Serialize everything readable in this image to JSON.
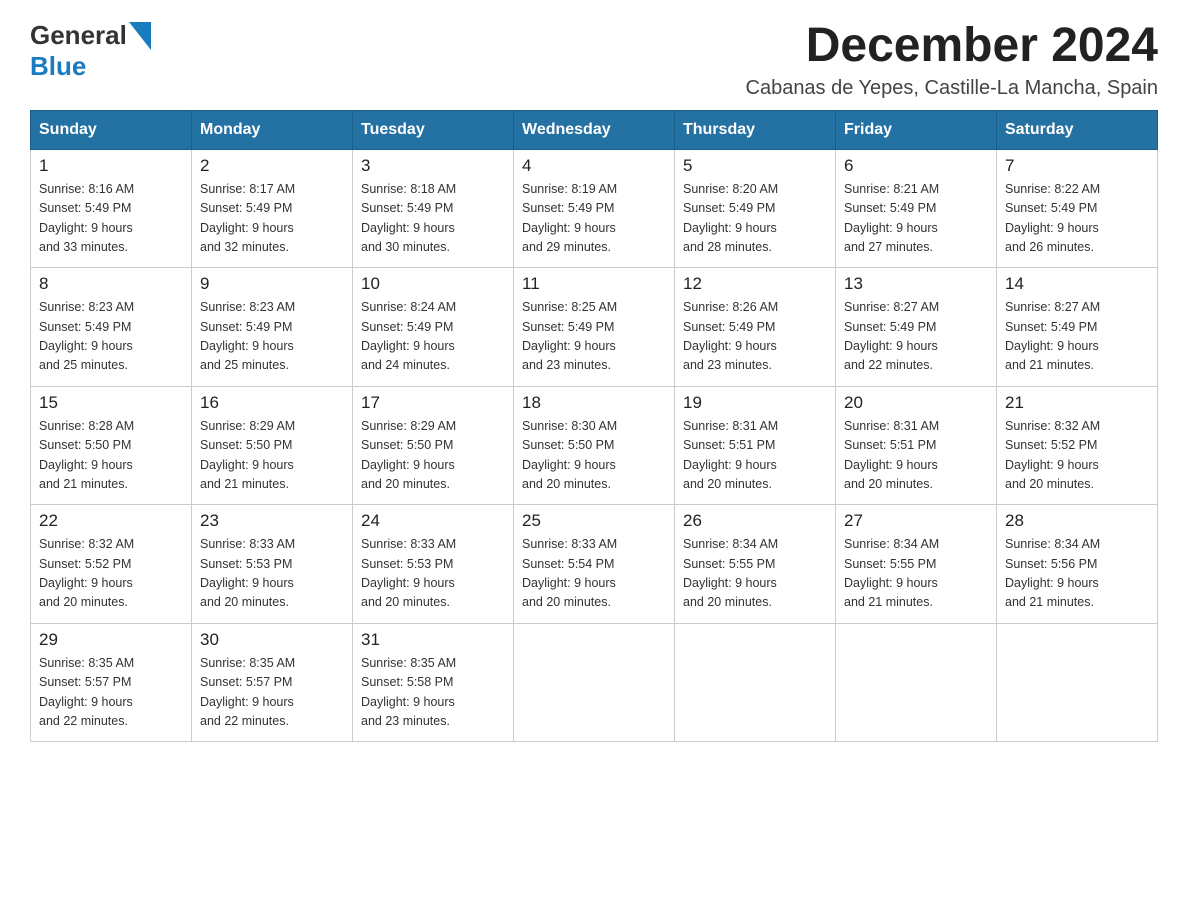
{
  "header": {
    "logo_general": "General",
    "logo_blue": "Blue",
    "month_title": "December 2024",
    "location": "Cabanas de Yepes, Castille-La Mancha, Spain"
  },
  "weekdays": [
    "Sunday",
    "Monday",
    "Tuesday",
    "Wednesday",
    "Thursday",
    "Friday",
    "Saturday"
  ],
  "weeks": [
    [
      {
        "day": "1",
        "sunrise": "8:16 AM",
        "sunset": "5:49 PM",
        "daylight": "9 hours and 33 minutes."
      },
      {
        "day": "2",
        "sunrise": "8:17 AM",
        "sunset": "5:49 PM",
        "daylight": "9 hours and 32 minutes."
      },
      {
        "day": "3",
        "sunrise": "8:18 AM",
        "sunset": "5:49 PM",
        "daylight": "9 hours and 30 minutes."
      },
      {
        "day": "4",
        "sunrise": "8:19 AM",
        "sunset": "5:49 PM",
        "daylight": "9 hours and 29 minutes."
      },
      {
        "day": "5",
        "sunrise": "8:20 AM",
        "sunset": "5:49 PM",
        "daylight": "9 hours and 28 minutes."
      },
      {
        "day": "6",
        "sunrise": "8:21 AM",
        "sunset": "5:49 PM",
        "daylight": "9 hours and 27 minutes."
      },
      {
        "day": "7",
        "sunrise": "8:22 AM",
        "sunset": "5:49 PM",
        "daylight": "9 hours and 26 minutes."
      }
    ],
    [
      {
        "day": "8",
        "sunrise": "8:23 AM",
        "sunset": "5:49 PM",
        "daylight": "9 hours and 25 minutes."
      },
      {
        "day": "9",
        "sunrise": "8:23 AM",
        "sunset": "5:49 PM",
        "daylight": "9 hours and 25 minutes."
      },
      {
        "day": "10",
        "sunrise": "8:24 AM",
        "sunset": "5:49 PM",
        "daylight": "9 hours and 24 minutes."
      },
      {
        "day": "11",
        "sunrise": "8:25 AM",
        "sunset": "5:49 PM",
        "daylight": "9 hours and 23 minutes."
      },
      {
        "day": "12",
        "sunrise": "8:26 AM",
        "sunset": "5:49 PM",
        "daylight": "9 hours and 23 minutes."
      },
      {
        "day": "13",
        "sunrise": "8:27 AM",
        "sunset": "5:49 PM",
        "daylight": "9 hours and 22 minutes."
      },
      {
        "day": "14",
        "sunrise": "8:27 AM",
        "sunset": "5:49 PM",
        "daylight": "9 hours and 21 minutes."
      }
    ],
    [
      {
        "day": "15",
        "sunrise": "8:28 AM",
        "sunset": "5:50 PM",
        "daylight": "9 hours and 21 minutes."
      },
      {
        "day": "16",
        "sunrise": "8:29 AM",
        "sunset": "5:50 PM",
        "daylight": "9 hours and 21 minutes."
      },
      {
        "day": "17",
        "sunrise": "8:29 AM",
        "sunset": "5:50 PM",
        "daylight": "9 hours and 20 minutes."
      },
      {
        "day": "18",
        "sunrise": "8:30 AM",
        "sunset": "5:50 PM",
        "daylight": "9 hours and 20 minutes."
      },
      {
        "day": "19",
        "sunrise": "8:31 AM",
        "sunset": "5:51 PM",
        "daylight": "9 hours and 20 minutes."
      },
      {
        "day": "20",
        "sunrise": "8:31 AM",
        "sunset": "5:51 PM",
        "daylight": "9 hours and 20 minutes."
      },
      {
        "day": "21",
        "sunrise": "8:32 AM",
        "sunset": "5:52 PM",
        "daylight": "9 hours and 20 minutes."
      }
    ],
    [
      {
        "day": "22",
        "sunrise": "8:32 AM",
        "sunset": "5:52 PM",
        "daylight": "9 hours and 20 minutes."
      },
      {
        "day": "23",
        "sunrise": "8:33 AM",
        "sunset": "5:53 PM",
        "daylight": "9 hours and 20 minutes."
      },
      {
        "day": "24",
        "sunrise": "8:33 AM",
        "sunset": "5:53 PM",
        "daylight": "9 hours and 20 minutes."
      },
      {
        "day": "25",
        "sunrise": "8:33 AM",
        "sunset": "5:54 PM",
        "daylight": "9 hours and 20 minutes."
      },
      {
        "day": "26",
        "sunrise": "8:34 AM",
        "sunset": "5:55 PM",
        "daylight": "9 hours and 20 minutes."
      },
      {
        "day": "27",
        "sunrise": "8:34 AM",
        "sunset": "5:55 PM",
        "daylight": "9 hours and 21 minutes."
      },
      {
        "day": "28",
        "sunrise": "8:34 AM",
        "sunset": "5:56 PM",
        "daylight": "9 hours and 21 minutes."
      }
    ],
    [
      {
        "day": "29",
        "sunrise": "8:35 AM",
        "sunset": "5:57 PM",
        "daylight": "9 hours and 22 minutes."
      },
      {
        "day": "30",
        "sunrise": "8:35 AM",
        "sunset": "5:57 PM",
        "daylight": "9 hours and 22 minutes."
      },
      {
        "day": "31",
        "sunrise": "8:35 AM",
        "sunset": "5:58 PM",
        "daylight": "9 hours and 23 minutes."
      },
      null,
      null,
      null,
      null
    ]
  ],
  "labels": {
    "sunrise_prefix": "Sunrise: ",
    "sunset_prefix": "Sunset: ",
    "daylight_prefix": "Daylight: "
  }
}
